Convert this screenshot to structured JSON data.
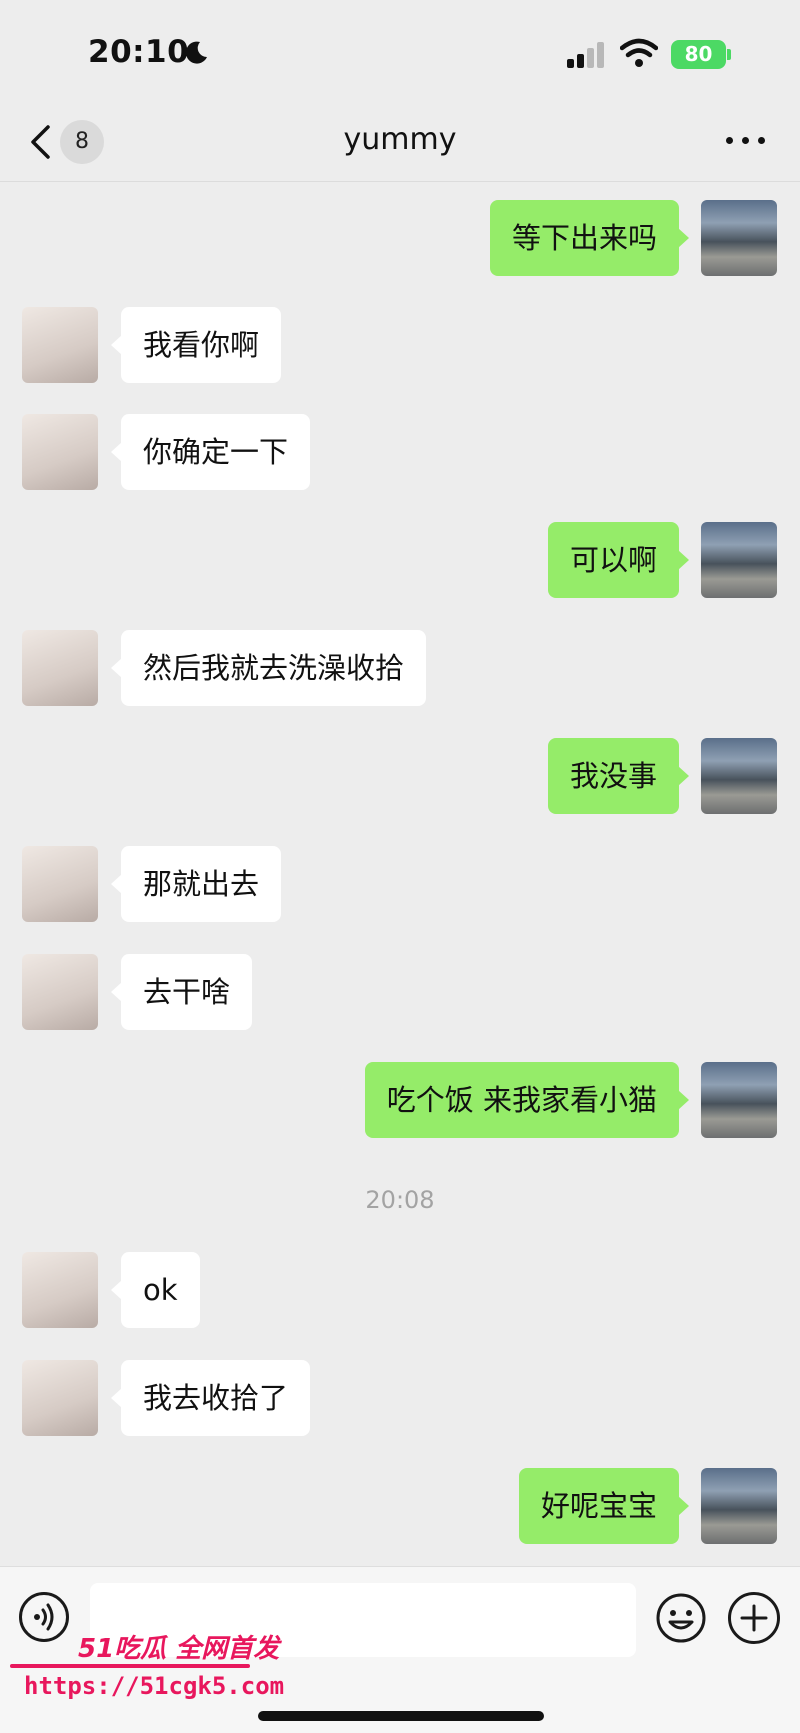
{
  "status_bar": {
    "time": "20:10",
    "battery": "80"
  },
  "title_bar": {
    "unread_count": "8",
    "title": "yummy"
  },
  "messages": [
    {
      "side": "me",
      "text": "等下出来吗"
    },
    {
      "side": "them",
      "text": "我看你啊"
    },
    {
      "side": "them",
      "text": "你确定一下"
    },
    {
      "side": "me",
      "text": "可以啊"
    },
    {
      "side": "them",
      "text": "然后我就去洗澡收拾"
    },
    {
      "side": "me",
      "text": "我没事"
    },
    {
      "side": "them",
      "text": "那就出去"
    },
    {
      "side": "them",
      "text": "去干啥"
    },
    {
      "side": "me",
      "text": "吃个饭 来我家看小猫"
    },
    {
      "timestamp": "20:08"
    },
    {
      "side": "them",
      "text": "ok"
    },
    {
      "side": "them",
      "text": "我去收拾了"
    },
    {
      "side": "me",
      "text": "好呢宝宝"
    }
  ],
  "input": {
    "value": ""
  },
  "watermark": {
    "brand": "51吃瓜 全网首发",
    "url": "https://51cgk5.com"
  },
  "colors": {
    "bubble_me": "#95ec69",
    "bubble_them": "#ffffff",
    "background": "#ededed",
    "battery": "#4cd964",
    "watermark": "#e8175d"
  }
}
